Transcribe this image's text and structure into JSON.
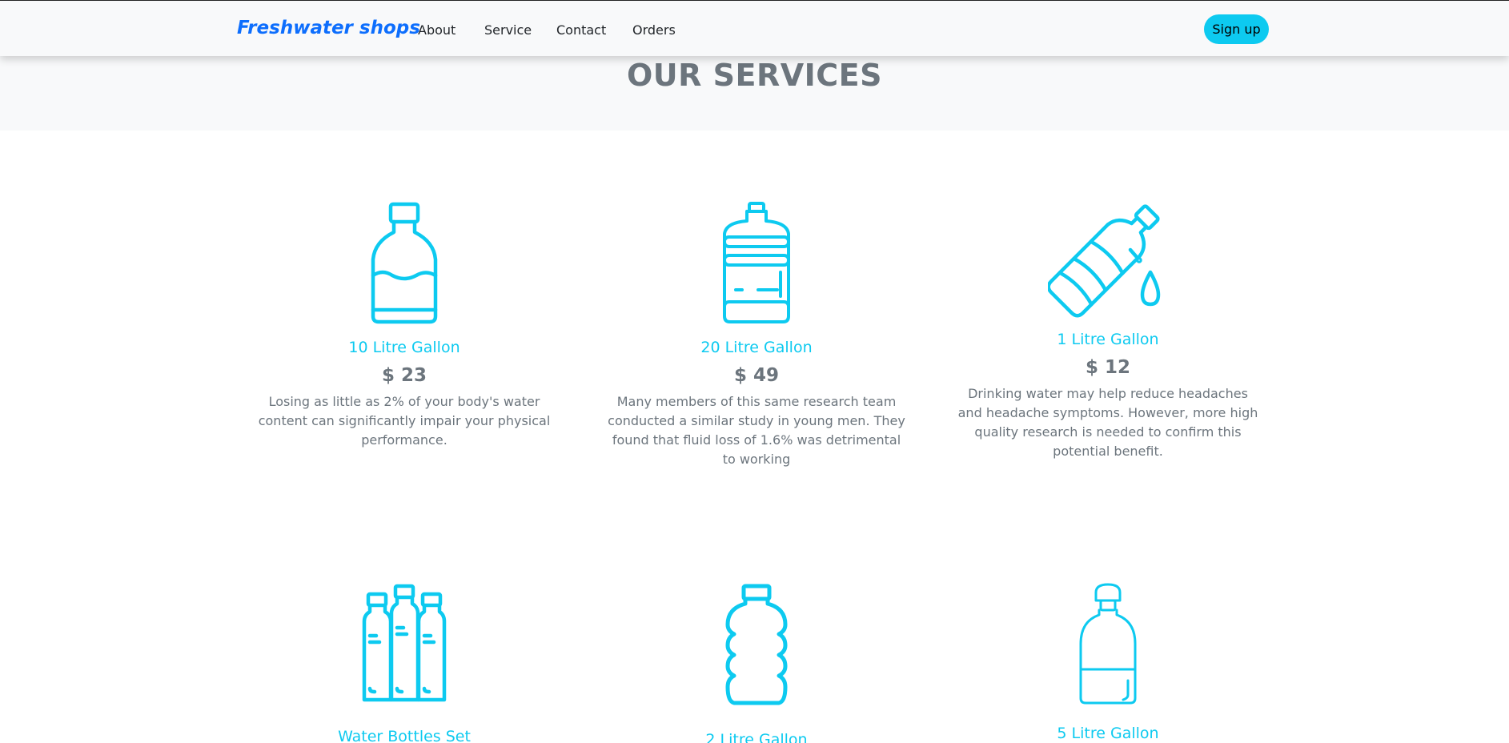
{
  "navbar": {
    "brand": "Freshwater shops",
    "links": [
      "About",
      "Service",
      "Contact",
      "Orders"
    ],
    "signup_label": "Sign up"
  },
  "section": {
    "title": "OUR SERVICES"
  },
  "products": [
    {
      "name": "10 Litre Gallon",
      "price": "$ 23",
      "description": "Losing as little as 2% of your body's water content can significantly impair your physical performance.",
      "icon": "water-jug-icon"
    },
    {
      "name": "20 Litre Gallon",
      "price": "$ 49",
      "description": "Many members of this same research team conducted a similar study in young men. They found that fluid loss of 1.6% was detrimental to working",
      "icon": "water-cooler-bottle-icon"
    },
    {
      "name": "1 Litre Gallon",
      "price": "$ 12",
      "description": "Drinking water may help reduce headaches and headache symptoms. However, more high quality research is needed to confirm this potential benefit.",
      "icon": "pouring-bottle-icon"
    },
    {
      "name": "Water Bottles Set",
      "icon": "bottles-set-icon"
    },
    {
      "name": "2 Litre Gallon",
      "icon": "ribbed-bottle-icon"
    },
    {
      "name": "5 Litre Gallon",
      "icon": "round-bottle-icon"
    }
  ],
  "colors": {
    "accent": "#0dcaf0",
    "brand": "#0d6efd",
    "muted": "#6c757d",
    "navbar_bg": "#f8f9fa"
  }
}
